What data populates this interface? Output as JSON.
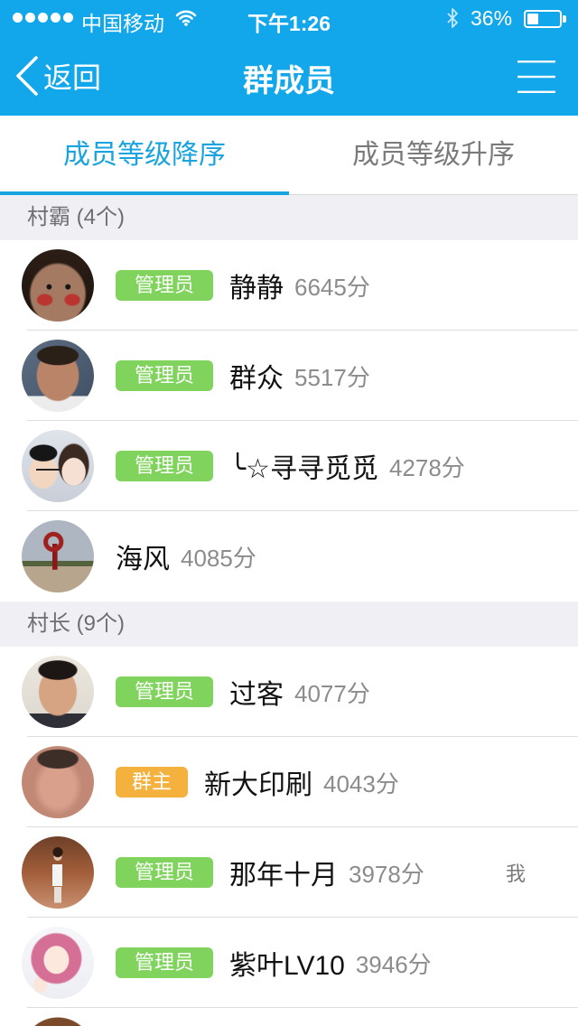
{
  "status_bar": {
    "signal_bars": 5,
    "carrier": "中国移动",
    "time": "下午1:26",
    "battery_text": "36%",
    "battery_level": 0.36,
    "icons": [
      "signal-dot-icon",
      "wifi-icon",
      "bluetooth-icon",
      "battery-icon"
    ]
  },
  "nav": {
    "back_label": "返回",
    "title": "群成员",
    "icons": [
      "chevron-left-icon",
      "menu-icon"
    ]
  },
  "tabs": [
    {
      "label": "成员等级降序",
      "active": true
    },
    {
      "label": "成员等级升序",
      "active": false
    }
  ],
  "sections": [
    {
      "title": "村霸 (4个)",
      "members": [
        {
          "badge": "管理员",
          "name": "静静",
          "score": "6645分"
        },
        {
          "badge": "管理员",
          "name": "群众",
          "score": "5517分"
        },
        {
          "badge": "管理员",
          "name": "╰☆寻寻觅觅",
          "score": "4278分"
        },
        {
          "name": "海风",
          "score": "4085分"
        }
      ]
    },
    {
      "title": "村长 (9个)",
      "members": [
        {
          "badge": "管理员",
          "name": "过客",
          "score": "4077分"
        },
        {
          "badge": "群主",
          "name": "新大印刷",
          "score": "4043分"
        },
        {
          "badge": "管理员",
          "name": "那年十月",
          "score": "3978分",
          "self_tag": "我"
        },
        {
          "badge": "管理员",
          "name": "紫叶LV10",
          "score": "3946分"
        }
      ]
    }
  ],
  "colors": {
    "header": "#12a6ea",
    "active_tab": "#19a3df",
    "badge_admin": "#80d35c",
    "badge_owner": "#f4b13d",
    "section_bg": "#efeff4"
  }
}
